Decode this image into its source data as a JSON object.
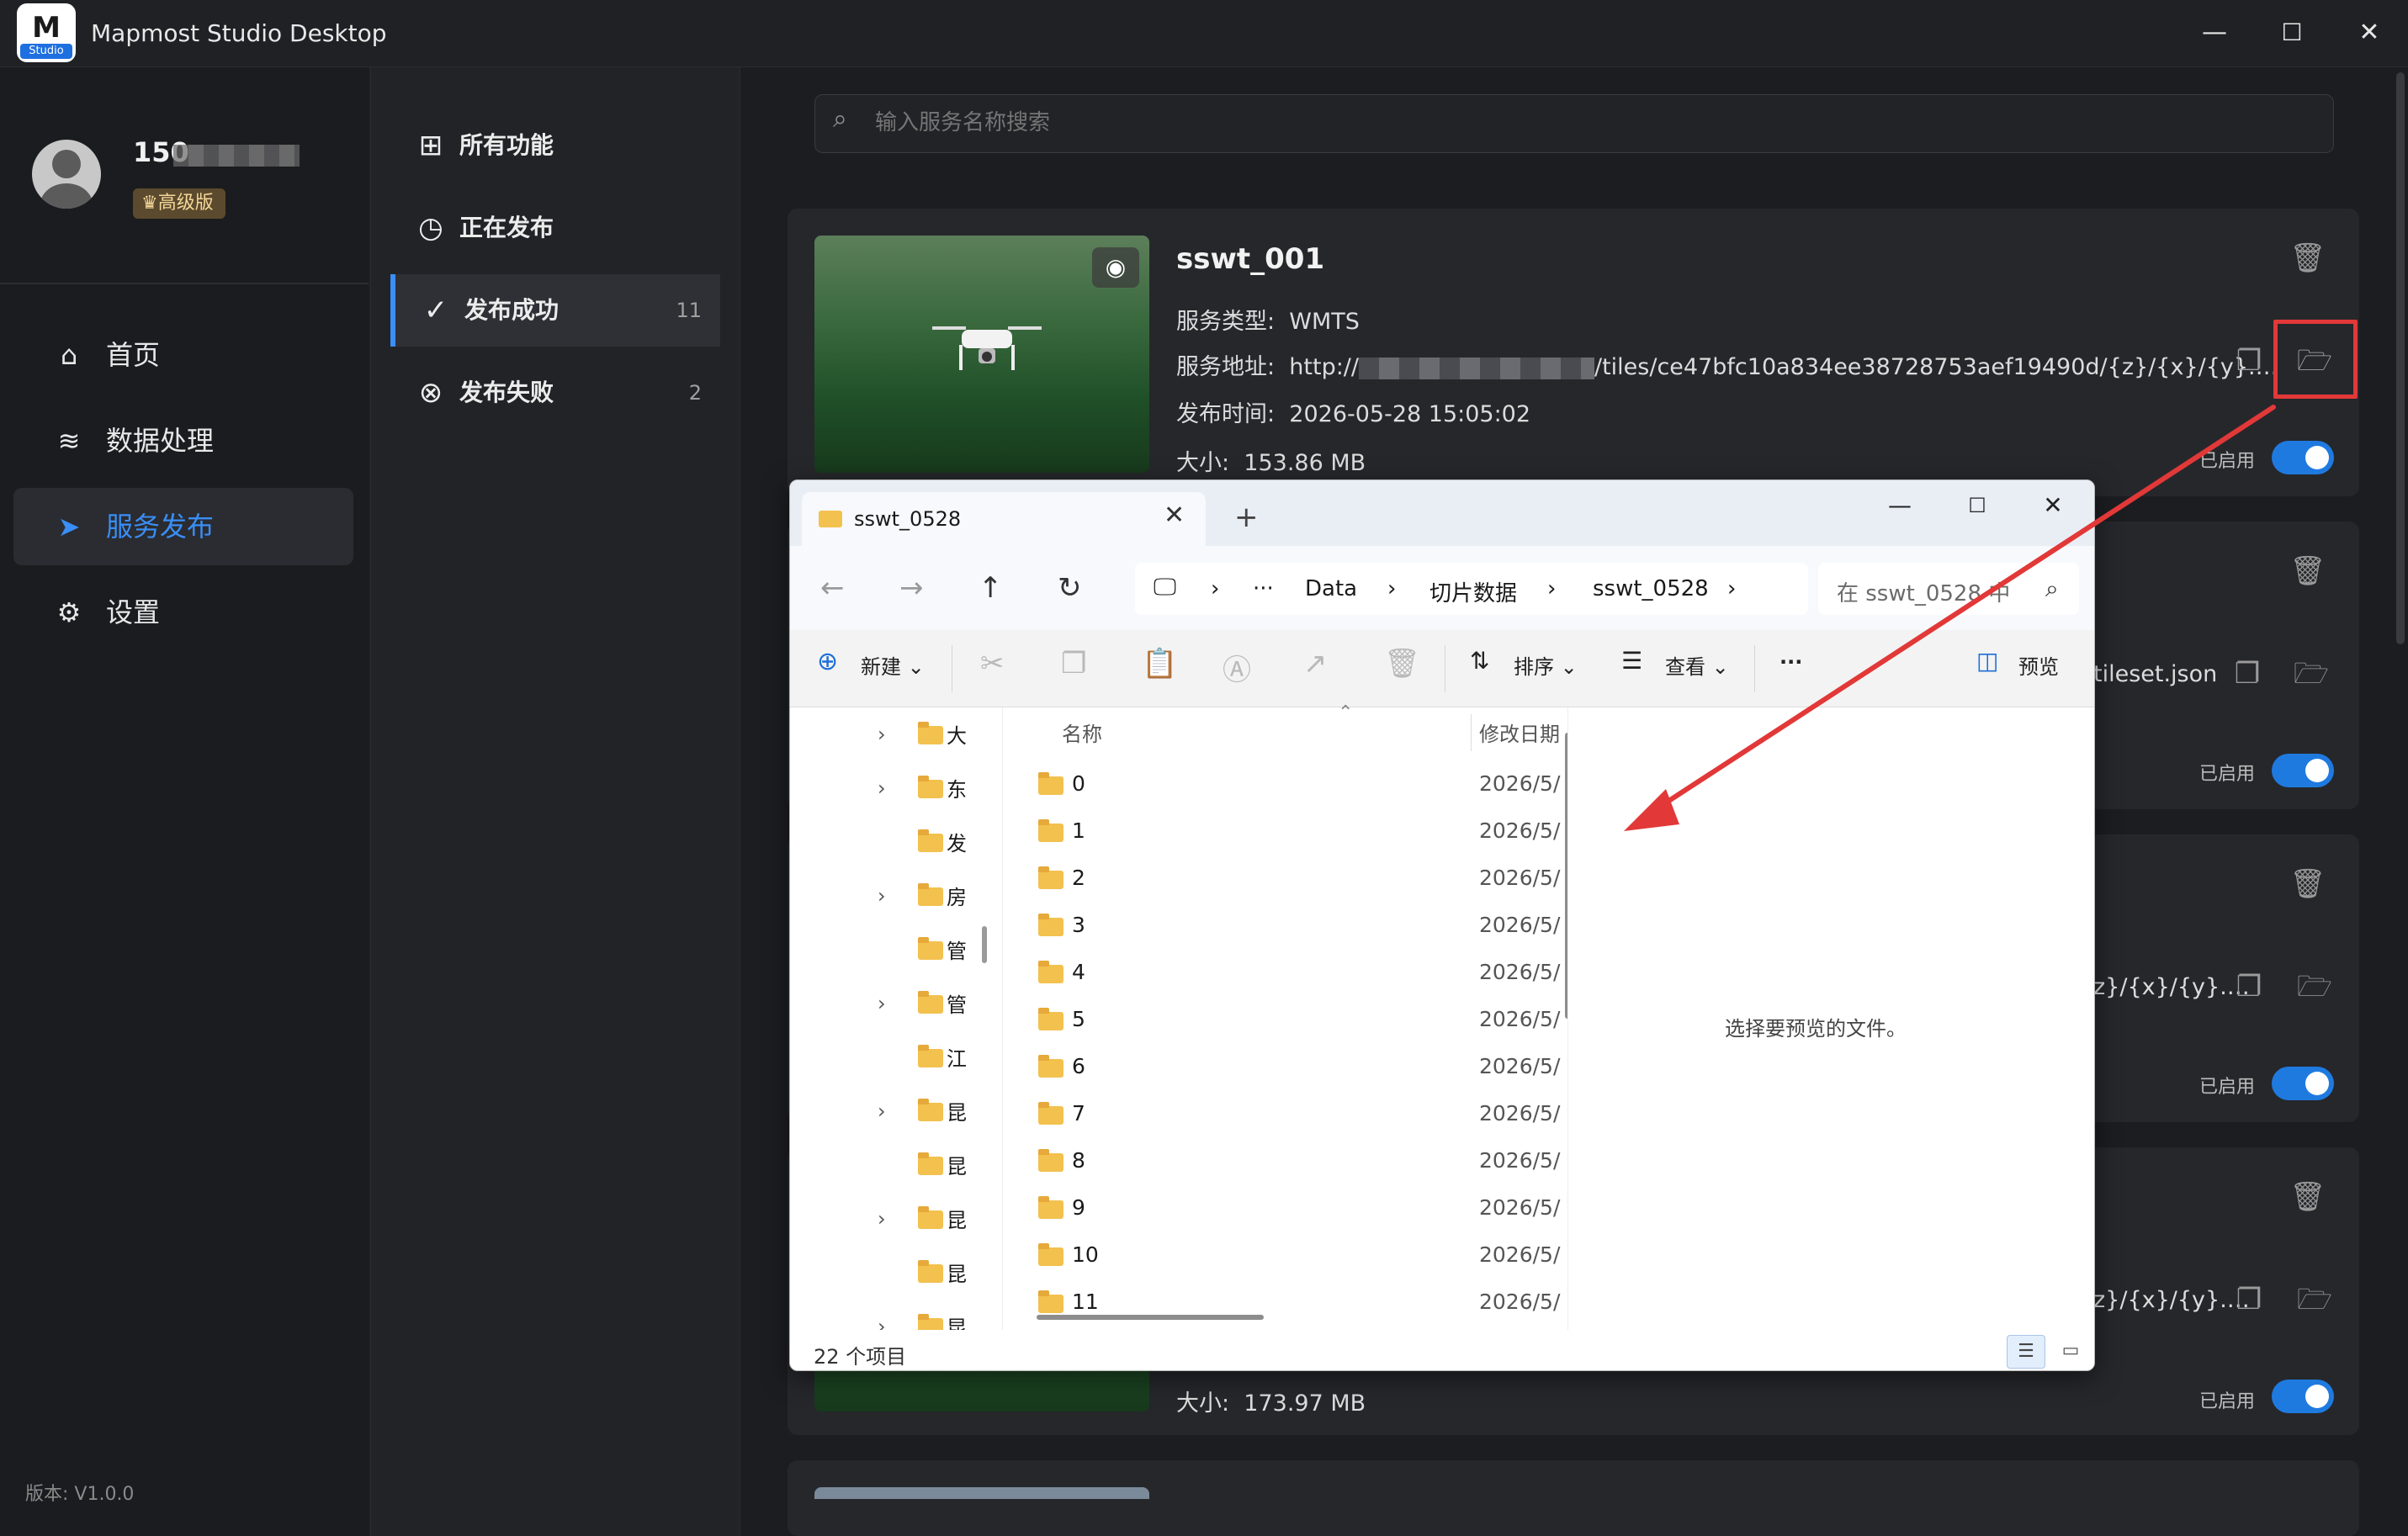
{
  "app": {
    "title": "Mapmost Studio Desktop",
    "logo_badge": "Studio",
    "logo_letter": "M"
  },
  "window_controls": {
    "minimize": "—",
    "maximize": "☐",
    "close": "✕"
  },
  "user": {
    "name_prefix": "150",
    "tier": "♛高级版"
  },
  "nav": [
    {
      "label": "首页",
      "icon": "home-icon"
    },
    {
      "label": "数据处理",
      "icon": "database-icon"
    },
    {
      "label": "服务发布",
      "icon": "send-icon",
      "active": true
    },
    {
      "label": "设置",
      "icon": "gear-icon"
    }
  ],
  "version": "版本: V1.0.0",
  "submenu": [
    {
      "label": "所有功能",
      "count": ""
    },
    {
      "label": "正在发布",
      "count": ""
    },
    {
      "label": "发布成功",
      "count": "11",
      "active": true
    },
    {
      "label": "发布失败",
      "count": "2"
    }
  ],
  "search": {
    "placeholder": "输入服务名称搜索"
  },
  "cards": [
    {
      "name": "sswt_001",
      "type_label": "服务类型:",
      "type": "WMTS",
      "url_label": "服务地址:",
      "url_prefix": "http://",
      "url_suffix": "/tiles/ce47bfc10a834ee38728753aef19490d/{z}/{x}/{y}.…",
      "time_label": "发布时间:",
      "time": "2026-05-28 15:05:02",
      "size_label": "大小:",
      "size": "153.86 MB",
      "enabled": "已启用"
    },
    {
      "url_suffix": "tileset.json",
      "enabled": "已启用"
    },
    {
      "url_suffix": "z}/{x}/{y}.…",
      "enabled": "已启用"
    },
    {
      "url_suffix": "z}/{x}/{y}.…",
      "size_label": "大小:",
      "size": "173.97 MB",
      "enabled": "已启用"
    }
  ],
  "explorer": {
    "tab_title": "sswt_0528",
    "new_tab": "+",
    "breadcrumb": [
      "Data",
      "切片数据",
      "sswt_0528"
    ],
    "breadcrumb_more": "···",
    "search_placeholder": "在 sswt_0528 中",
    "toolbar": {
      "new": "新建",
      "sort": "排序",
      "view": "查看",
      "more": "···",
      "preview": "预览"
    },
    "tree": [
      {
        "name": "大",
        "chevron": true
      },
      {
        "name": "东",
        "chevron": true
      },
      {
        "name": "发",
        "chevron": false
      },
      {
        "name": "房",
        "chevron": true
      },
      {
        "name": "管",
        "chevron": false
      },
      {
        "name": "管",
        "chevron": true
      },
      {
        "name": "江",
        "chevron": false
      },
      {
        "name": "昆",
        "chevron": true
      },
      {
        "name": "昆",
        "chevron": false
      },
      {
        "name": "昆",
        "chevron": true
      },
      {
        "name": "昆",
        "chevron": false
      },
      {
        "name": "昆",
        "chevron": true
      }
    ],
    "columns": {
      "name": "名称",
      "date": "修改日期"
    },
    "files": [
      {
        "name": "0",
        "date": "2026/5/"
      },
      {
        "name": "1",
        "date": "2026/5/"
      },
      {
        "name": "2",
        "date": "2026/5/"
      },
      {
        "name": "3",
        "date": "2026/5/"
      },
      {
        "name": "4",
        "date": "2026/5/"
      },
      {
        "name": "5",
        "date": "2026/5/"
      },
      {
        "name": "6",
        "date": "2026/5/"
      },
      {
        "name": "7",
        "date": "2026/5/"
      },
      {
        "name": "8",
        "date": "2026/5/"
      },
      {
        "name": "9",
        "date": "2026/5/"
      },
      {
        "name": "10",
        "date": "2026/5/"
      },
      {
        "name": "11",
        "date": "2026/5/"
      }
    ],
    "preview_text": "选择要预览的文件。",
    "status_count": "22 个项目"
  },
  "colors": {
    "accent": "#3a8ef5",
    "highlight": "#e23838",
    "toggle_on": "#1f7ae0"
  }
}
